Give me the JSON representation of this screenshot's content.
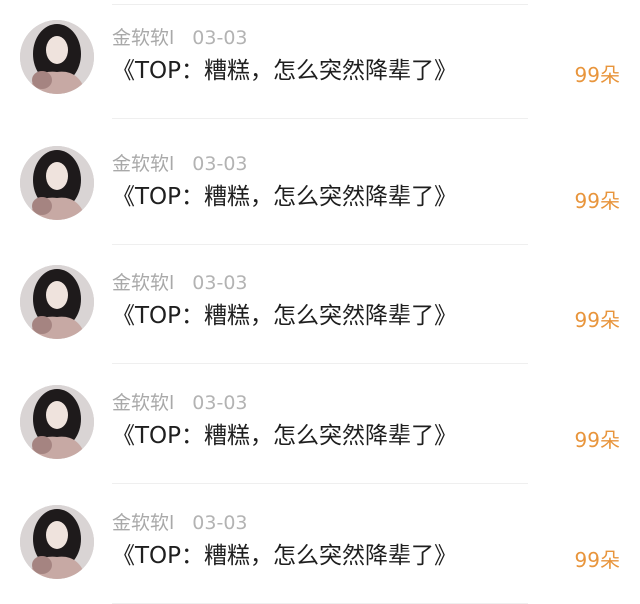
{
  "comments": [
    {
      "username": "金软软l",
      "date": "03-03",
      "text": "《TOP：糟糕，怎么突然降辈了》",
      "gift": "99朵",
      "avatar_icon": "user-avatar-icon"
    },
    {
      "username": "金软软l",
      "date": "03-03",
      "text": "《TOP：糟糕，怎么突然降辈了》",
      "gift": "99朵",
      "avatar_icon": "user-avatar-icon"
    },
    {
      "username": "金软软l",
      "date": "03-03",
      "text": "《TOP：糟糕，怎么突然降辈了》",
      "gift": "99朵",
      "avatar_icon": "user-avatar-icon"
    },
    {
      "username": "金软软l",
      "date": "03-03",
      "text": "《TOP：糟糕，怎么突然降辈了》",
      "gift": "99朵",
      "avatar_icon": "user-avatar-icon"
    },
    {
      "username": "金软软l",
      "date": "03-03",
      "text": "《TOP：糟糕，怎么突然降辈了》",
      "gift": "99朵",
      "avatar_icon": "user-avatar-icon"
    }
  ],
  "colors": {
    "username": "#a9a9a9",
    "text": "#1f1f1f",
    "gift": "#e8953c",
    "divider": "#efefef"
  }
}
